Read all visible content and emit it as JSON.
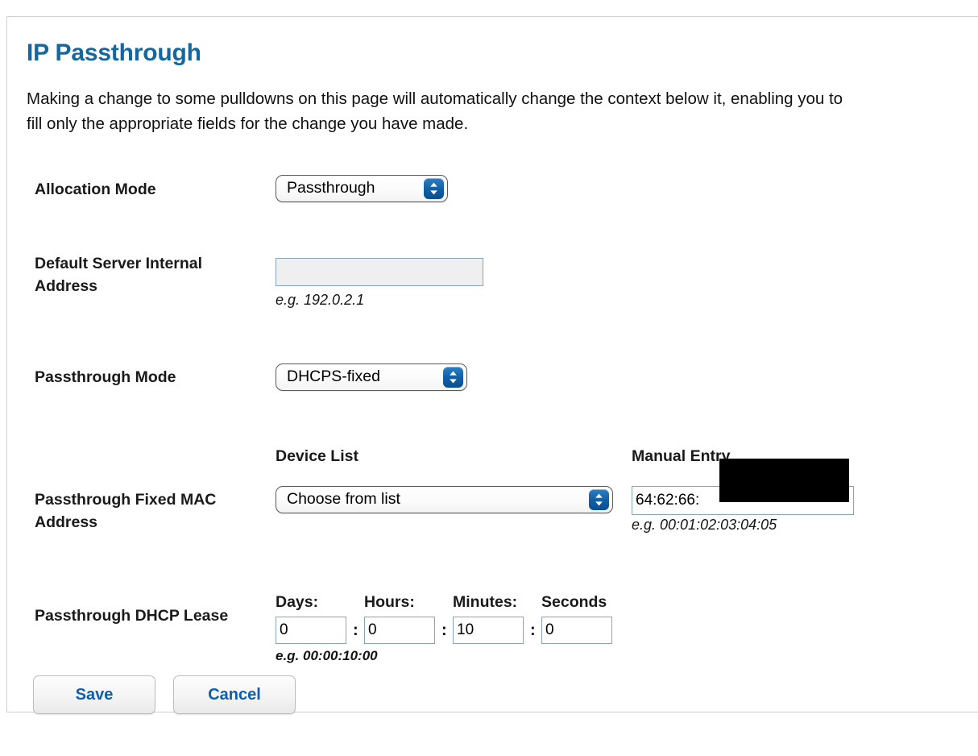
{
  "page": {
    "title": "IP Passthrough",
    "intro": "Making a change to some pulldowns on this page will automatically change the context below it, enabling you to\nfill only the appropriate fields for the change you have made.",
    "title_color": "#14679f",
    "accent_color": "#0b5fb0"
  },
  "fields": {
    "allocation_mode": {
      "label": "Allocation Mode",
      "value": "Passthrough",
      "icon": "chevron-updown-icon"
    },
    "default_server_internal_address": {
      "label": "Default Server Internal Address",
      "value": "",
      "placeholder": "",
      "hint": "e.g. 192.0.2.1",
      "disabled": true
    },
    "passthrough_mode": {
      "label": "Passthrough Mode",
      "value": "DHCPS-fixed",
      "icon": "chevron-updown-icon"
    },
    "passthrough_fixed_mac": {
      "label": "Passthrough Fixed MAC Address",
      "device_list_heading": "Device List",
      "device_list_value": "Choose from list",
      "manual_entry_heading": "Manual Entry",
      "manual_entry_value": "64:62:66:",
      "hint": "e.g. 00:01:02:03:04:05",
      "redacted": true
    },
    "passthrough_dhcp_lease": {
      "label": "Passthrough DHCP Lease",
      "hint": "e.g. 00:00:10:00",
      "units": [
        {
          "heading": "Days:",
          "value": "0"
        },
        {
          "heading": "Hours:",
          "value": "0"
        },
        {
          "heading": "Minutes:",
          "value": "10"
        },
        {
          "heading": "Seconds",
          "value": "0"
        }
      ],
      "separator": ":"
    }
  },
  "buttons": {
    "save": "Save",
    "cancel": "Cancel"
  }
}
